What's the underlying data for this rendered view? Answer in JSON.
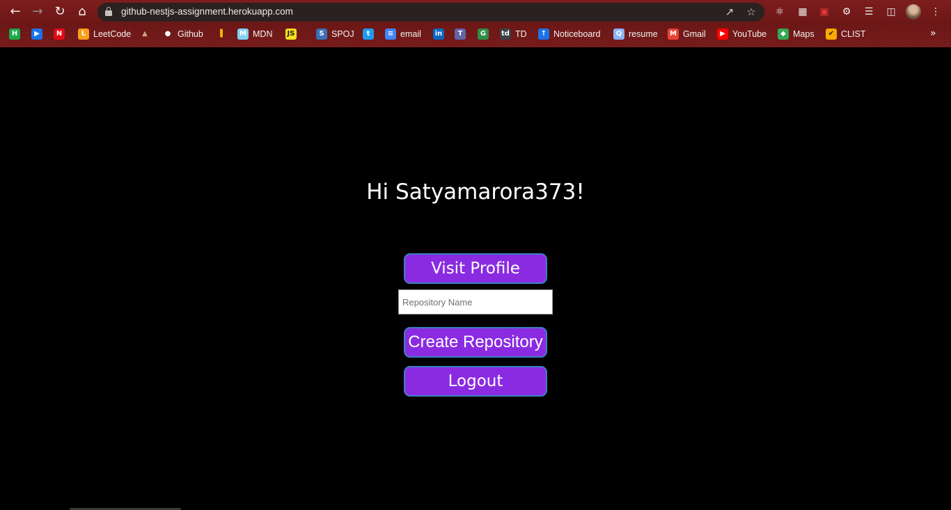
{
  "browser": {
    "url": "github-nestjs-assignment.herokuapp.com",
    "bookmarks": [
      {
        "label": "",
        "icon": "hackerrank-icon",
        "color": "#1ba94c"
      },
      {
        "label": "",
        "icon": "play-icon",
        "color": "#1a73e8"
      },
      {
        "label": "",
        "icon": "netflix-icon",
        "color": "#e50914"
      },
      {
        "label": "LeetCode",
        "icon": "leetcode-icon",
        "color": "#f89f1b"
      },
      {
        "label": "",
        "icon": "codechef-icon",
        "color": "#c9a47e"
      },
      {
        "label": "Github",
        "icon": "github-icon",
        "color": "#ffffff"
      },
      {
        "label": "",
        "icon": "chart-icon",
        "color": "#f4b400"
      },
      {
        "label": "MDN",
        "icon": "mdn-icon",
        "color": "#83d0f2"
      },
      {
        "label": "",
        "icon": "js-icon",
        "color": "#f7df1e"
      },
      {
        "label": "SPOJ",
        "icon": "spoj-icon",
        "color": "#3b6fb6"
      },
      {
        "label": "",
        "icon": "twitter-icon",
        "color": "#1d9bf0"
      },
      {
        "label": "email",
        "icon": "docs-icon",
        "color": "#4285f4"
      },
      {
        "label": "",
        "icon": "linkedin-icon",
        "color": "#0a66c2"
      },
      {
        "label": "",
        "icon": "teams-icon",
        "color": "#6264a7"
      },
      {
        "label": "",
        "icon": "geeksforgeeks-icon",
        "color": "#2f8d46"
      },
      {
        "label": "TD",
        "icon": "td-icon",
        "color": "#3c4043"
      },
      {
        "label": "Noticeboard",
        "icon": "pin-icon",
        "color": "#1a73e8"
      },
      {
        "label": "resume",
        "icon": "search-doc-icon",
        "color": "#8ab4f8"
      },
      {
        "label": "Gmail",
        "icon": "gmail-icon",
        "color": "#ea4335"
      },
      {
        "label": "YouTube",
        "icon": "youtube-icon",
        "color": "#ff0000"
      },
      {
        "label": "Maps",
        "icon": "maps-icon",
        "color": "#34a853"
      },
      {
        "label": "CLIST",
        "icon": "clist-icon",
        "color": "#f9ab00"
      }
    ]
  },
  "page": {
    "greeting": "Hi Satyamarora373!",
    "visit_profile_label": "Visit Profile",
    "repo_placeholder": "Repository Name",
    "repo_value": "",
    "create_repo_label": "Create Repository",
    "logout_label": "Logout"
  },
  "colors": {
    "button_bg": "#8a2be2",
    "button_border": "#3c7fc4",
    "page_bg": "#000000"
  }
}
